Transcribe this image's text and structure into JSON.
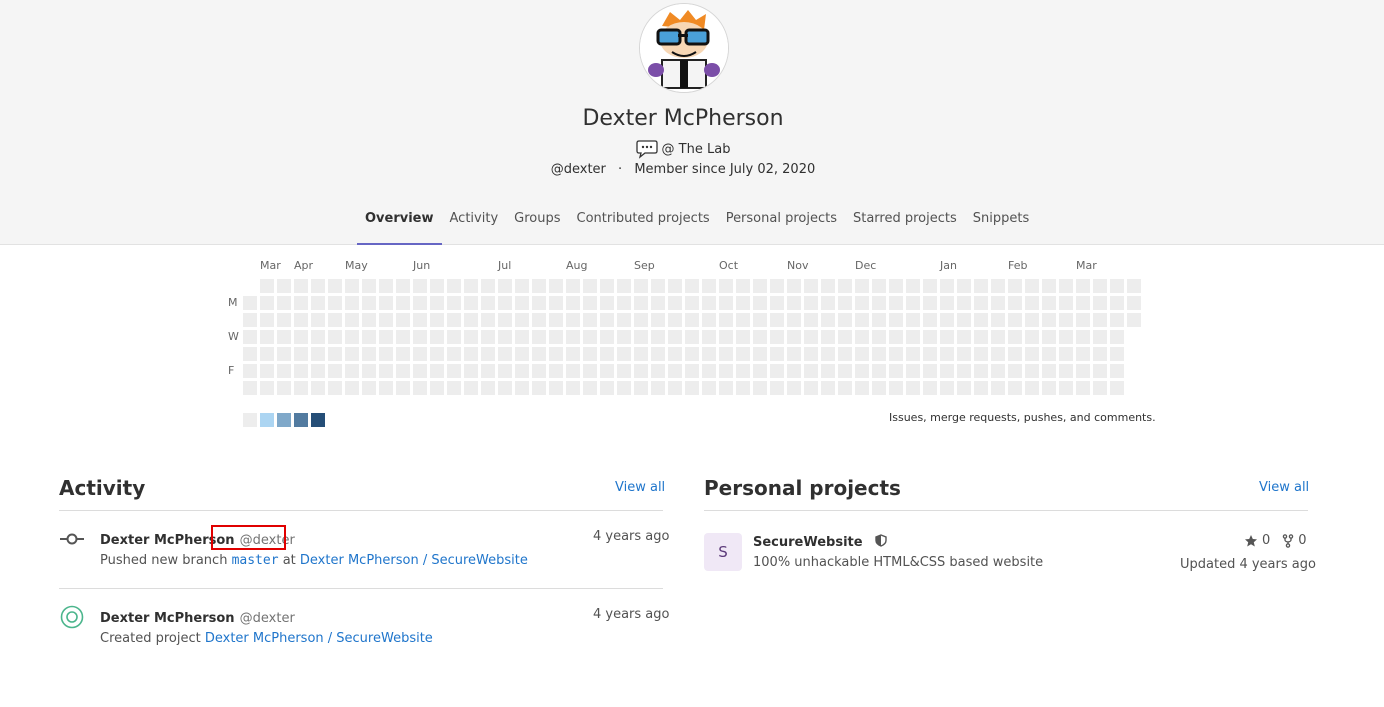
{
  "profile": {
    "name": "Dexter McPherson",
    "bio": "@ The Lab",
    "username": "@dexter",
    "member_since": "Member since July 02, 2020"
  },
  "tabs": [
    {
      "label": "Overview",
      "active": true
    },
    {
      "label": "Activity"
    },
    {
      "label": "Groups"
    },
    {
      "label": "Contributed projects"
    },
    {
      "label": "Personal projects"
    },
    {
      "label": "Starred projects"
    },
    {
      "label": "Snippets"
    }
  ],
  "calendar": {
    "months": [
      "Mar",
      "Apr",
      "May",
      "Jun",
      "Jul",
      "Aug",
      "Sep",
      "Oct",
      "Nov",
      "Dec",
      "Jan",
      "Feb",
      "Mar"
    ],
    "days": [
      "M",
      "W",
      "F"
    ],
    "legend_colors": [
      "#ededed",
      "#acd5f2",
      "#7fa8c9",
      "#527ba0",
      "#254e77"
    ],
    "note": "Issues, merge requests, pushes, and comments."
  },
  "activity": {
    "title": "Activity",
    "view_all": "View all",
    "events": [
      {
        "icon": "commit-icon",
        "name": "Dexter McPherson",
        "user": "@dexter",
        "time": "4 years ago",
        "text": "Pushed new branch",
        "branch": "master",
        "at": "at",
        "link": "Dexter McPherson / SecureWebsite"
      },
      {
        "icon": "project-created-icon",
        "name": "Dexter McPherson",
        "user": "@dexter",
        "time": "4 years ago",
        "text": "Created project",
        "link": "Dexter McPherson / SecureWebsite"
      }
    ]
  },
  "personal_projects": {
    "title": "Personal projects",
    "view_all": "View all",
    "items": [
      {
        "avatar_letter": "S",
        "name": "SecureWebsite",
        "description": "100% unhackable HTML&CSS based website",
        "stars": "0",
        "forks": "0",
        "updated": "Updated 4 years ago"
      }
    ]
  }
}
